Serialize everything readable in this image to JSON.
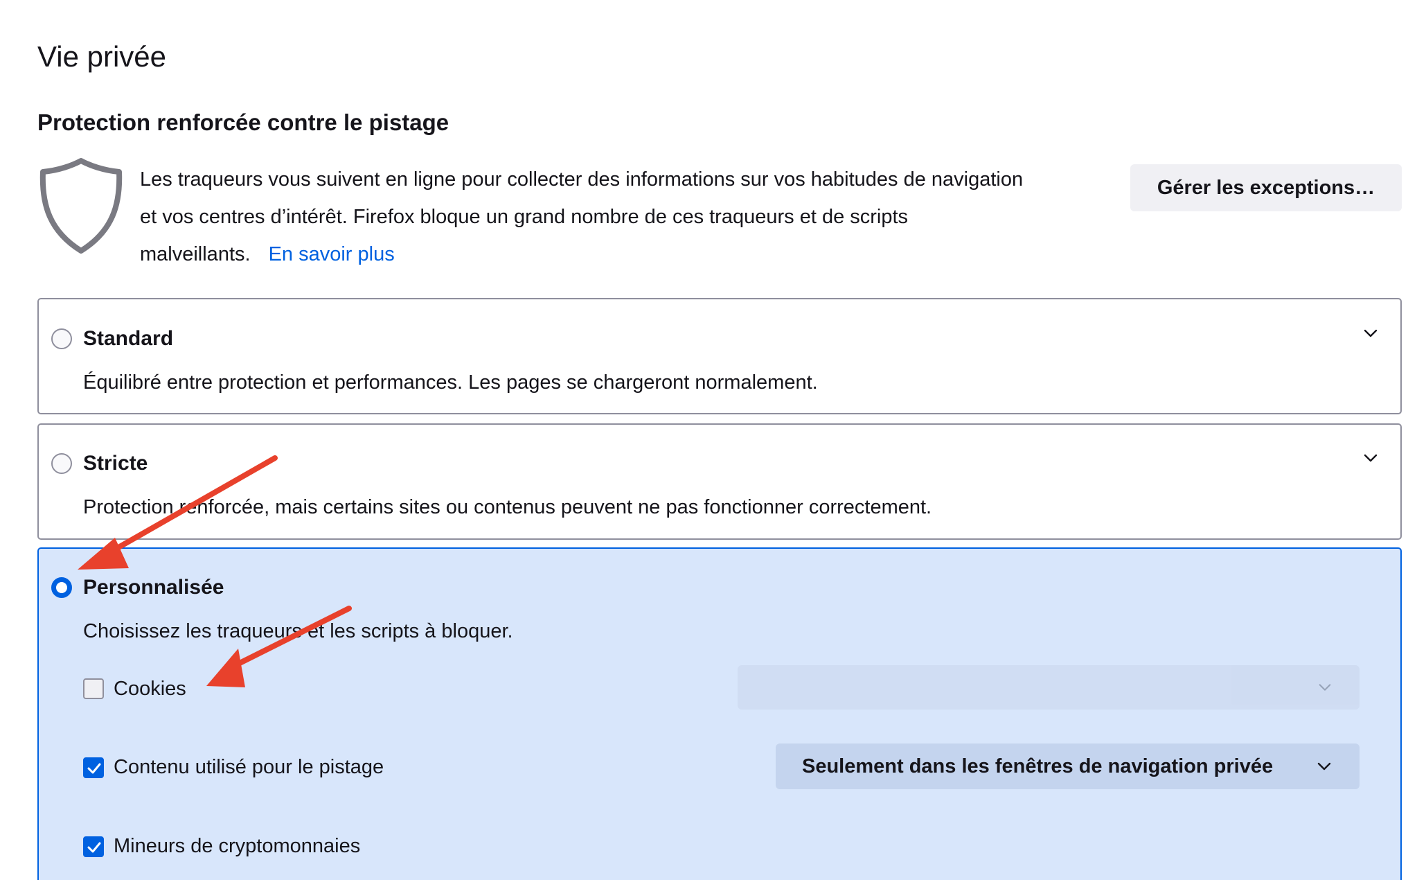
{
  "page": {
    "title": "Vie privée"
  },
  "tracking_protection": {
    "heading": "Protection renforcée contre le pistage",
    "description_line1": "Les traqueurs vous suivent en ligne pour collecter des informations sur vos habitudes de navigation",
    "description_line2": "et vos centres d’intérêt. Firefox bloque un grand nombre de ces traqueurs et de scripts",
    "description_line3": "malveillants.",
    "learn_more_label": "En savoir plus",
    "exceptions_button_label": "Gérer les exceptions…"
  },
  "options": {
    "standard": {
      "label": "Standard",
      "description": "Équilibré entre protection et performances. Les pages se chargeront normalement.",
      "selected": false
    },
    "strict": {
      "label": "Stricte",
      "description": "Protection renforcée, mais certains sites ou contenus peuvent ne pas fonctionner correctement.",
      "selected": false
    },
    "custom": {
      "label": "Personnalisée",
      "description": "Choisissez les traqueurs et les scripts à bloquer.",
      "selected": true,
      "items": [
        {
          "label": "Cookies",
          "checked": false,
          "select_value": ""
        },
        {
          "label": "Contenu utilisé pour le pistage",
          "checked": true,
          "select_value": "Seulement dans les fenêtres de navigation privée"
        },
        {
          "label": "Mineurs de cryptomonnaies",
          "checked": true
        }
      ]
    }
  },
  "colors": {
    "accent": "#0061e0",
    "selected_card_bg": "#d8e6fb",
    "annotation_arrow": "#e8412c"
  },
  "icons": {
    "shield": "shield-icon",
    "chevron": "chevron-down-icon",
    "check": "check-icon"
  }
}
